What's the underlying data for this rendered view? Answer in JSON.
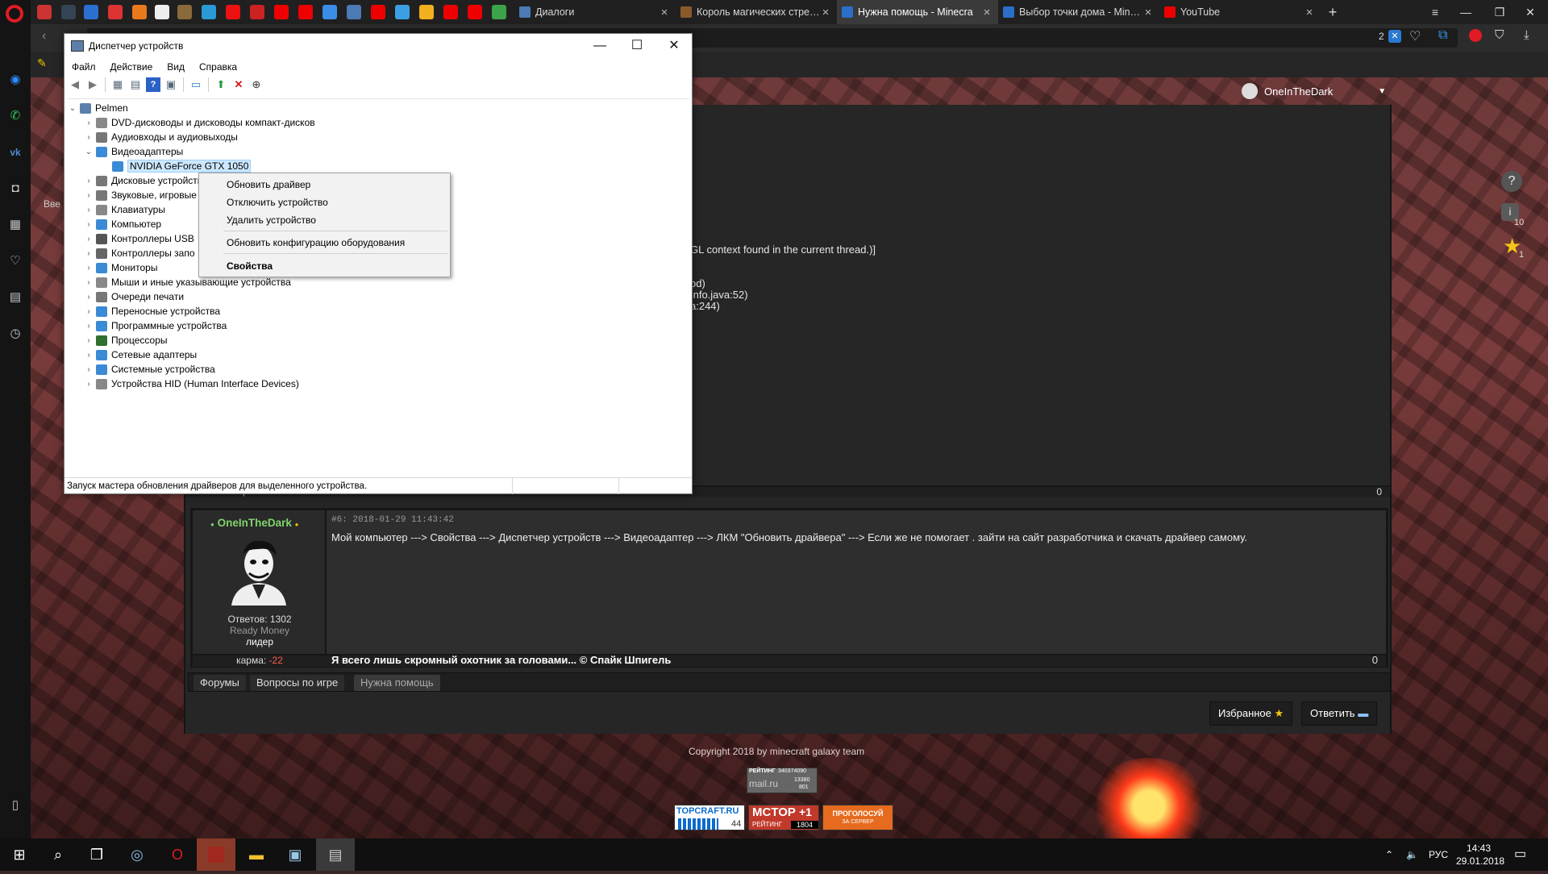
{
  "browser": {
    "tabs": [
      {
        "label": "Диалоги",
        "active": false
      },
      {
        "label": "Король магических стре…",
        "active": false
      },
      {
        "label": "Нужна помощь - Minecra",
        "active": true
      },
      {
        "label": "Выбор точки дома - Min…",
        "active": false
      },
      {
        "label": "YouTube",
        "active": false
      }
    ],
    "new_tab": "+",
    "badge_count": "2",
    "sidebar_icons": [
      "messenger-icon",
      "whatsapp-icon",
      "vk-icon",
      "camera-icon",
      "grid-icon",
      "heart-icon",
      "news-icon",
      "history-icon"
    ]
  },
  "forum": {
    "user_name": "OneInTheDark",
    "user_menu_arrow": "▼",
    "log_lines": [
      "GL context found in the current thread.)]",
      "od)",
      "Info.java:52)",
      "a:244)"
    ],
    "left_stub": "Вве",
    "right_icons": {
      "help": "?",
      "info_count": "10",
      "star_count": "1"
    },
    "previous_post_counter": "0",
    "previous_post_karma": "карма: -",
    "post": {
      "author": "OneInTheDark",
      "meta": "#6: 2018-01-29 11:43:42",
      "text": "Мой компьютер ---> Свойства ---> Диспетчер устройств ---> Видеоадаптер ---> ЛКМ \"Обновить драйвера\" ---> Если же не помогает . зайти на сайт разработчика и скачать драйвер самому.",
      "replies": "Ответов: 1302",
      "money": "Ready Money",
      "rank": "лидер",
      "karma_label": "карма:",
      "karma_value": "-22",
      "signature": "Я всего лишь скромный охотник за головами... © Спайк Шпигель",
      "counter": "0"
    },
    "breadcrumb": [
      "Форумы",
      "Вопросы по игре",
      "Нужна помощь"
    ],
    "favorite_button": "Избранное",
    "reply_button": "Ответить",
    "copyright": "Copyright 2018 by minecraft galaxy team",
    "counters": {
      "mailru_label": "РЕЙТИНГ",
      "mailru_line1": "340374090",
      "mailru_logo": "mail.ru",
      "mailru_a": "13380",
      "mailru_b": "801",
      "topcraft": "TOPCRAFT.RU",
      "topcraft_num": "44",
      "mctop": "MCTOP",
      "mctop_plus": "+1",
      "mctop_rating": "РЕЙТИНГ",
      "mctop_num": "1804",
      "vote_top": "ПРОГОЛОСУЙ",
      "vote_bottom": "ЗА СЕРВЕР"
    }
  },
  "device_manager": {
    "title": "Диспетчер устройств",
    "menu": [
      "Файл",
      "Действие",
      "Вид",
      "Справка"
    ],
    "root": "Pelmen",
    "nodes": [
      "DVD-дисководы и дисководы компакт-дисков",
      "Аудиовходы и аудиовыходы",
      "Видеоадаптеры",
      "NVIDIA GeForce GTX 1050",
      "Дисковые устройства",
      "Звуковые, игровые",
      "Клавиатуры",
      "Компьютер",
      "Контроллеры USB",
      "Контроллеры запо",
      "Мониторы",
      "Мыши и иные указывающие устройства",
      "Очереди печати",
      "Переносные устройства",
      "Программные устройства",
      "Процессоры",
      "Сетевые адаптеры",
      "Системные устройства",
      "Устройства HID (Human Interface Devices)"
    ],
    "context_menu": [
      "Обновить драйвер",
      "Отключить устройство",
      "Удалить устройство",
      "Обновить конфигурацию оборудования",
      "Свойства"
    ],
    "status": "Запуск мастера обновления драйверов для выделенного устройства."
  },
  "taskbar": {
    "lang": "РУС",
    "time": "14:43",
    "date": "29.01.2018"
  },
  "colors": {
    "accent_green": "#7fd36b",
    "karma_red": "#ff5a4e",
    "opera_red": "#e01b24"
  }
}
